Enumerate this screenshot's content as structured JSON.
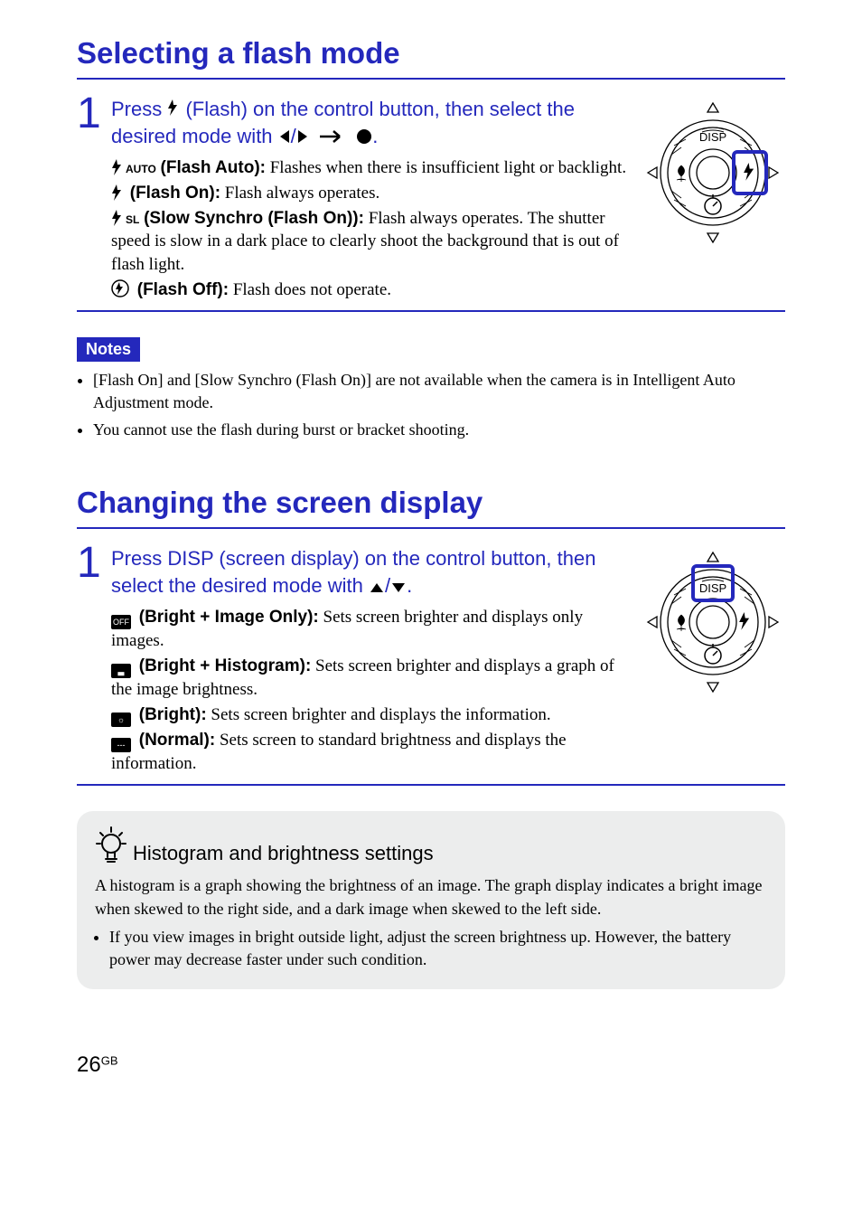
{
  "section1": {
    "title": "Selecting a flash mode",
    "step_num": "1",
    "instruction_pre": "Press ",
    "instruction_mid": " (Flash) on the control button, then select the desired mode with ",
    "instruction_post": ".",
    "modes": {
      "auto": {
        "label": " (Flash Auto):",
        "desc": " Flashes when there is insufficient light or backlight."
      },
      "on": {
        "label": " (Flash On):",
        "desc": " Flash always operates."
      },
      "slow": {
        "label": " (Slow Synchro (Flash On)):",
        "desc": " Flash always operates. The shutter speed is slow in a dark place to clearly shoot the background that is out of flash light."
      },
      "off": {
        "label": " (Flash Off):",
        "desc": " Does not operate.",
        "desc_full": " Flash does not operate."
      }
    }
  },
  "notes": {
    "tag": "Notes",
    "items": [
      "[Flash On] and [Slow Synchro (Flash On)] are not available when the camera is in Intelligent Auto Adjustment mode.",
      "You cannot use the flash during burst or bracket shooting."
    ]
  },
  "section2": {
    "title": "Changing the screen display",
    "step_num": "1",
    "instruction_pre": "Press DISP (screen display) on the control button, then select the desired mode with ",
    "instruction_post": ".",
    "modes": {
      "bio": {
        "label": " (Bright + Image Only):",
        "desc": " Sets screen brighter and displays only images."
      },
      "bhist": {
        "label": " (Bright + Histogram):",
        "desc": " Sets screen brighter and displays a graph of the image brightness."
      },
      "bright": {
        "label": " (Bright):",
        "desc": " Sets screen brighter and displays the information."
      },
      "normal": {
        "label": " (Normal):",
        "desc": " Sets screen to standard brightness and displays the information."
      }
    }
  },
  "tip": {
    "title": "Histogram and brightness settings",
    "para": "A histogram is a graph showing the brightness of an image. The graph display indicates a bright image when skewed to the right side, and a dark image when skewed to the left side.",
    "bullet": "If you view images in bright outside light, adjust the screen brightness up. However, the battery power may decrease faster under such condition."
  },
  "footer": {
    "page": "26",
    "lang": "GB"
  },
  "icons": {
    "flash_auto_text": "AUTO",
    "flash_sl_text": "SL",
    "disp_label": "DISP",
    "box_off": "OFF"
  }
}
